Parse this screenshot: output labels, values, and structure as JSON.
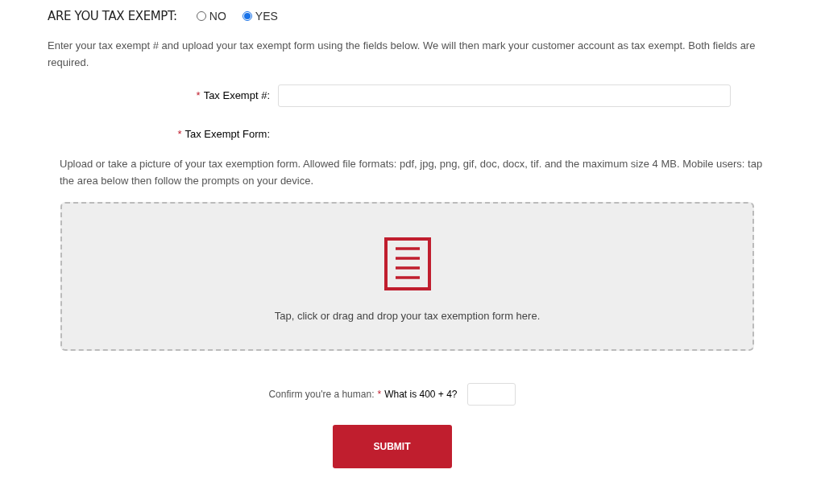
{
  "question": {
    "label": "ARE YOU TAX EXEMPT:",
    "options": [
      {
        "label": "NO",
        "selected": false
      },
      {
        "label": "YES",
        "selected": true
      }
    ]
  },
  "intro": "Enter your tax exempt # and upload your tax exempt form using the fields below. We will then mark your customer account as tax exempt. Both fields are required.",
  "tax_number": {
    "required_mark": "*",
    "label": "Tax Exempt #:"
  },
  "tax_form": {
    "required_mark": "*",
    "label": "Tax Exempt Form:"
  },
  "upload_help": "Upload or take a picture of your tax exemption form. Allowed file formats: pdf, jpg, png, gif, doc, docx, tif. and the maximum size 4 MB. Mobile users: tap the area below then follow the prompts on your device.",
  "dropzone": {
    "text": "Tap, click or drag and drop your tax exemption form here."
  },
  "captcha": {
    "prefix": "Confirm you're a human:",
    "required_mark": "*",
    "question": "What is 400 + 4?"
  },
  "submit": "SUBMIT"
}
